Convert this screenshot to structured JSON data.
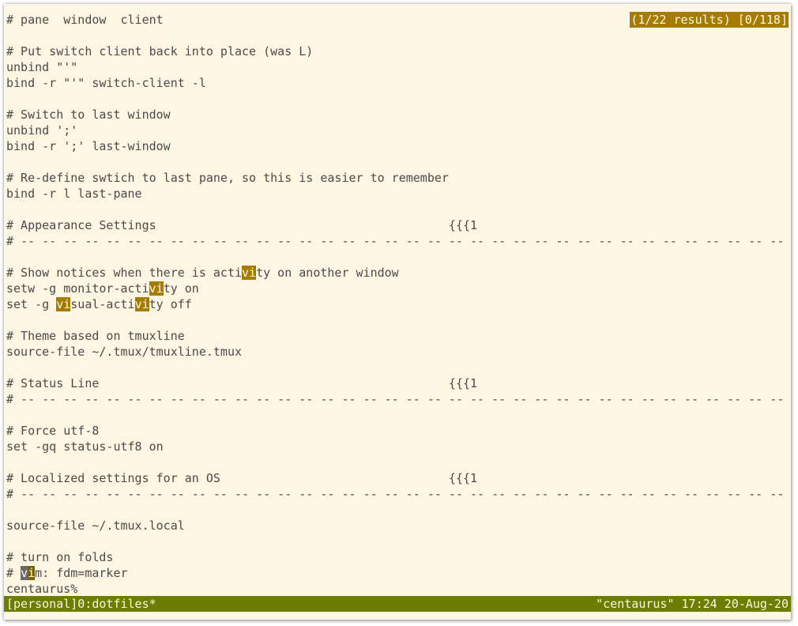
{
  "copy_mode": {
    "indicator": "(1/22 results) [0/118]"
  },
  "buffer": {
    "lines": {
      "l01": "# pane  window  client",
      "l02": "",
      "l03": "# Put switch client back into place (was L)",
      "l04": "unbind \"'\"",
      "l05": "bind -r \"'\" switch-client -l",
      "l06": "",
      "l07": "# Switch to last window",
      "l08": "unbind ';'",
      "l09": "bind -r ';' last-window",
      "l10": "",
      "l11": "# Re-define swtich to last pane, so this is easier to remember",
      "l12": "bind -r l last-pane",
      "l13": "",
      "l14": "# Appearance Settings                                         {{{1",
      "l15": "# -- -- -- -- -- -- -- -- -- -- -- -- -- -- -- -- -- -- -- -- -- -- -- -- -- -- -- -- -- -- -- -- -- -- -- --",
      "l16": "",
      "l17a": "# Show notices when there is acti",
      "l17b": "vi",
      "l17c": "ty on another window",
      "l18a": "setw -g monitor-acti",
      "l18b": "vi",
      "l18c": "ty on",
      "l19a": "set -g ",
      "l19b": "vi",
      "l19c": "sual-acti",
      "l19d": "vi",
      "l19e": "ty off",
      "l20": "",
      "l21": "# Theme based on tmuxline",
      "l22": "source-file ~/.tmux/tmuxline.tmux",
      "l23": "",
      "l24": "# Status Line                                                 {{{1",
      "l25": "# -- -- -- -- -- -- -- -- -- -- -- -- -- -- -- -- -- -- -- -- -- -- -- -- -- -- -- -- -- -- -- -- -- -- -- --",
      "l26": "",
      "l27": "# Force utf-8",
      "l28": "set -gq status-utf8 on",
      "l29": "",
      "l30": "# Localized settings for an OS                                {{{1",
      "l31": "# -- -- -- -- -- -- -- -- -- -- -- -- -- -- -- -- -- -- -- -- -- -- -- -- -- -- -- -- -- -- -- -- -- -- -- --",
      "l32": "",
      "l33": "source-file ~/.tmux.local",
      "l34": "",
      "l35": "# turn on folds",
      "l36a": "# ",
      "l36b": "v",
      "l36c": "i",
      "l36d": "m: fdm=marker",
      "l37": "centaurus%"
    }
  },
  "status_bar": {
    "left": "[personal]0:dotfiles*",
    "right": "\"centaurus\" 17:24 20-Aug-20"
  },
  "colors": {
    "background": "#fdf6e3",
    "text": "#4a4a4a",
    "search_highlight": "#a67c00",
    "status_bar": "#6b7e00",
    "cursor": "#6b6b6b"
  }
}
